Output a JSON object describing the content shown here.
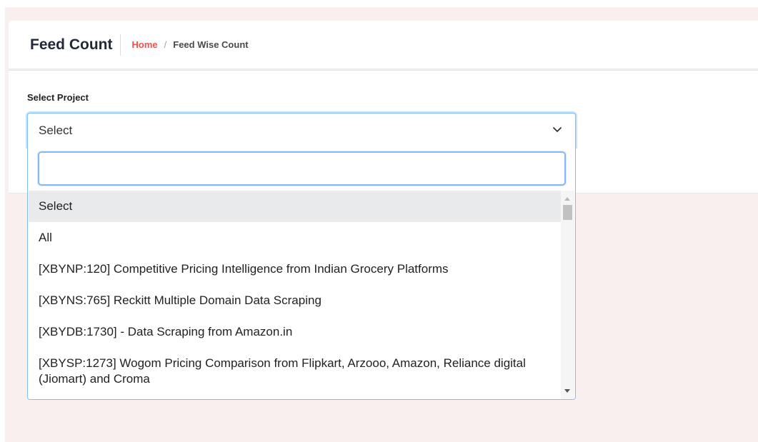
{
  "header": {
    "title": "Feed Count",
    "breadcrumb": {
      "home": "Home",
      "separator": "/",
      "current": "Feed Wise Count"
    }
  },
  "form": {
    "label": "Select Project",
    "select_value": "Select",
    "search_placeholder": "",
    "options": [
      {
        "label": "Select",
        "selected": true
      },
      {
        "label": "All"
      },
      {
        "label": "[XBYNP:120] Competitive Pricing Intelligence from Indian Grocery Platforms"
      },
      {
        "label": "[XBYNS:765] Reckitt Multiple Domain Data Scraping"
      },
      {
        "label": "[XBYDB:1730] - Data Scraping from Amazon.in"
      },
      {
        "label": "[XBYSP:1273] Wogom Pricing Comparison from Flipkart, Arzooo, Amazon, Reliance digital (Jiomart) and Croma"
      }
    ]
  },
  "colors": {
    "accent": "#f0504f",
    "page_bg": "#f8efee",
    "focus_border": "#80bdff"
  }
}
